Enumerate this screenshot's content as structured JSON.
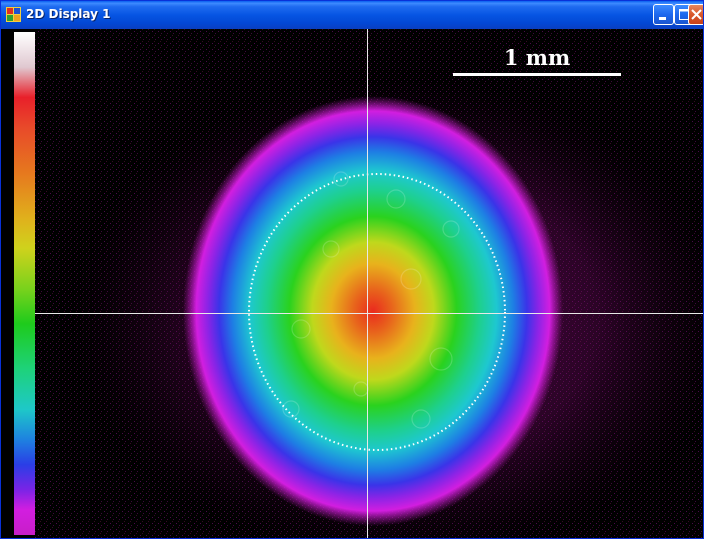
{
  "window": {
    "title": "2D Display 1",
    "controls": [
      "minimize",
      "maximize",
      "close"
    ]
  },
  "display": {
    "scale_bar_label": "1 mm",
    "colormap": [
      "#ffffff",
      "#e8202a",
      "#e6781e",
      "#cfd21c",
      "#1ecb1c",
      "#1ec8c8",
      "#2a3ee6",
      "#d21ee0"
    ],
    "background_color": "#000000",
    "crosshair_color": "#e8e8e8",
    "aperture_circle": "dotted-white-circle"
  },
  "colors": {
    "titlebar": "#0655e3",
    "close_button": "#d9582b"
  }
}
